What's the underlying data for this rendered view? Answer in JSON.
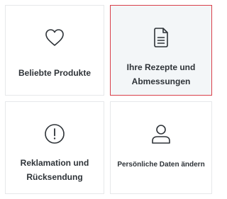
{
  "tiles": [
    {
      "label": "Beliebte Produkte",
      "icon": "heart-icon",
      "selected": false
    },
    {
      "label": "Ihre Rezepte und Abmessungen",
      "icon": "document-icon",
      "selected": true
    },
    {
      "label": "Reklamation und Rücksendung",
      "icon": "exclamation-circle-icon",
      "selected": false
    },
    {
      "label": "Persönliche Daten ändern",
      "icon": "user-icon",
      "selected": false
    }
  ],
  "colors": {
    "selected_border": "#d9404a",
    "selected_background": "#f3f6f8",
    "border": "#e6e8ea",
    "text": "#2e3338"
  }
}
